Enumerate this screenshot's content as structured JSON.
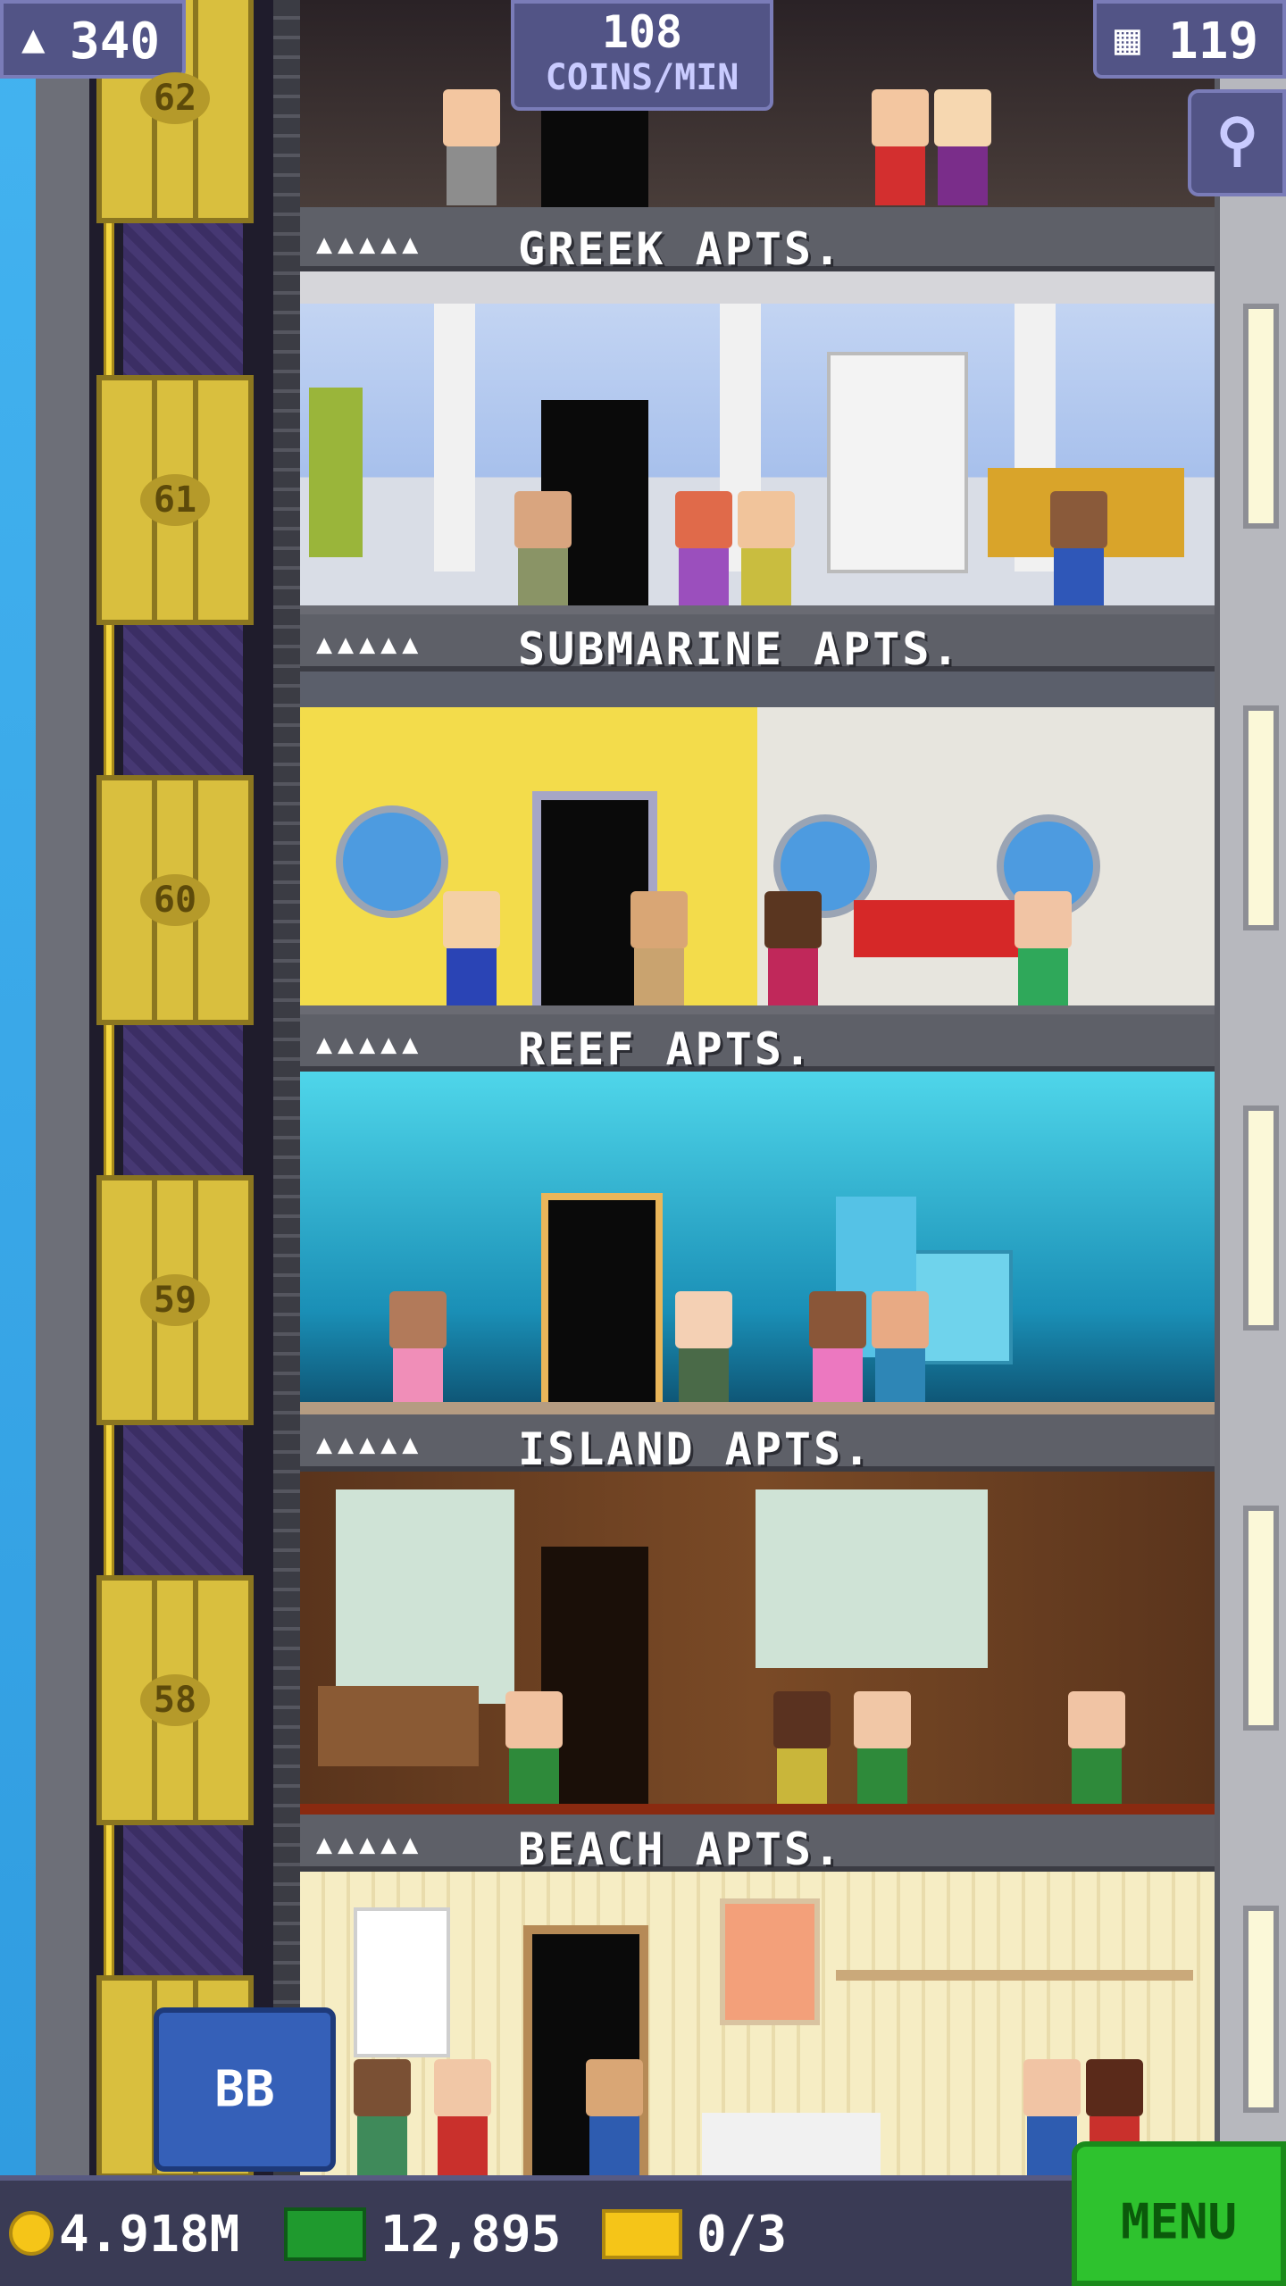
{
  "hud": {
    "population": "340",
    "coins_rate_value": "108",
    "coins_rate_unit": "COINS/MIN",
    "floors_count": "119"
  },
  "floors": [
    {
      "name": "GREEK APTS.",
      "pips": "▲▲▲▲▲",
      "elevator_floor": "61"
    },
    {
      "name": "SUBMARINE APTS.",
      "pips": "▲▲▲▲▲",
      "elevator_floor": "60"
    },
    {
      "name": "REEF APTS.",
      "pips": "▲▲▲▲▲",
      "elevator_floor": "59"
    },
    {
      "name": "ISLAND APTS.",
      "pips": "▲▲▲▲▲",
      "elevator_floor": "58"
    },
    {
      "name": "BEACH APTS.",
      "pips": "▲▲▲▲▲",
      "elevator_floor": ""
    }
  ],
  "top_floor_number": "62",
  "elevator_button": {
    "label": "BB"
  },
  "bottom": {
    "coins": "4.918M",
    "bux": "12,895",
    "tickets": "0/3",
    "menu_label": "MENU"
  },
  "colors": {
    "hud_bg": "#525486",
    "menu_green": "#2ec22e",
    "coin_gold": "#f5c518",
    "bux_green": "#1f9a2e"
  }
}
